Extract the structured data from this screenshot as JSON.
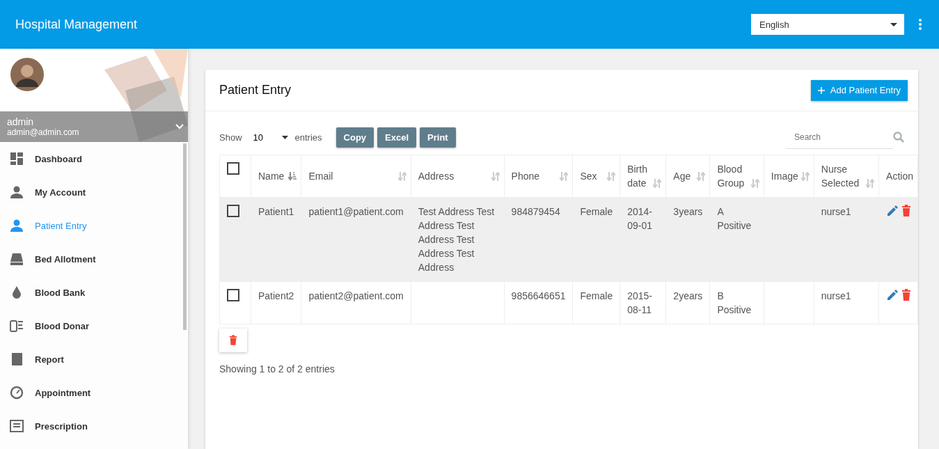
{
  "app_bar": {
    "title": "Hospital Management",
    "language": "English"
  },
  "sidebar": {
    "user": {
      "name": "admin",
      "email": "admin@admin.com"
    },
    "items": [
      {
        "label": "Dashboard",
        "selected": false
      },
      {
        "label": "My Account",
        "selected": false
      },
      {
        "label": "Patient Entry",
        "selected": true
      },
      {
        "label": "Bed Allotment",
        "selected": false
      },
      {
        "label": "Blood Bank",
        "selected": false
      },
      {
        "label": "Blood Donar",
        "selected": false
      },
      {
        "label": "Report",
        "selected": false
      },
      {
        "label": "Appointment",
        "selected": false
      },
      {
        "label": "Prescription",
        "selected": false
      }
    ]
  },
  "card": {
    "title": "Patient Entry",
    "add_button": "Add Patient Entry",
    "length": {
      "label_before": "Show",
      "value": "10",
      "label_after": "entries"
    },
    "export_buttons": [
      "Copy",
      "Excel",
      "Print"
    ],
    "search": {
      "placeholder": "Search"
    },
    "table": {
      "header_checked": false,
      "columns": [
        {
          "label": "Name",
          "sorted": true
        },
        {
          "label": "Email",
          "sorted": false
        },
        {
          "label": "Address",
          "sorted": false
        },
        {
          "label": "Phone",
          "sorted": false
        },
        {
          "label": "Sex",
          "sorted": false
        },
        {
          "label": "Birth date",
          "sorted": false
        },
        {
          "label": "Age",
          "sorted": false
        },
        {
          "label": "Blood Group",
          "sorted": false
        },
        {
          "label": "Image",
          "sorted": false
        },
        {
          "label": "Nurse Selected",
          "sorted": false
        }
      ],
      "action_column": "Action",
      "rows": [
        {
          "checked": false,
          "highlighted": true,
          "cells": [
            "Patient1",
            "patient1@patient.com",
            "Test Address Test Address Test Address Test Address Test Address",
            "984879454",
            "Female",
            "2014-09-01",
            "3years",
            "A Positive",
            "",
            "nurse1"
          ]
        },
        {
          "checked": false,
          "highlighted": false,
          "cells": [
            "Patient2",
            "patient2@patient.com",
            "",
            "9856646651",
            "Female",
            "2015-08-11",
            "2years",
            "B Positive",
            "",
            "nurse1"
          ]
        }
      ]
    },
    "info": "Showing 1 to 2 of 2 entries"
  }
}
